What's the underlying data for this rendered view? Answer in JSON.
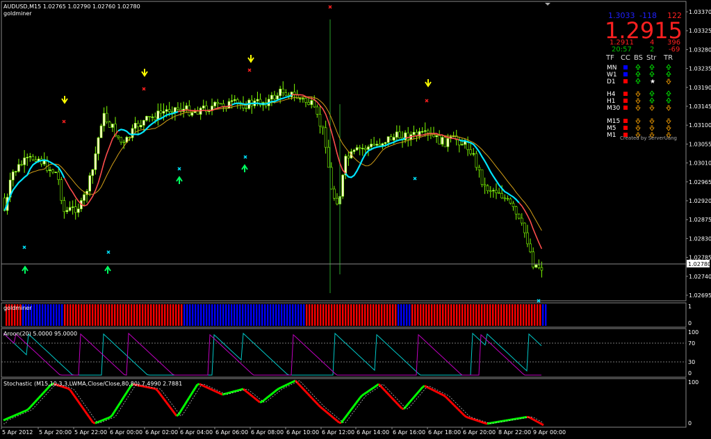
{
  "main_panel": {
    "header_line": "AUDUSD,M15  1.02765 1.02790 1.02760 1.02780",
    "indicator_name": "goldminer",
    "current_price_label": "1.02780",
    "y_ticks": [
      "1.03370",
      "1.03325",
      "1.03280",
      "1.03235",
      "1.03190",
      "1.03145",
      "1.03100",
      "1.03055",
      "1.03010",
      "1.02965",
      "1.02920",
      "1.02875",
      "1.02830",
      "1.02785",
      "1.02740",
      "1.02695"
    ]
  },
  "info_box": {
    "top_row": [
      "1.3033",
      "-118",
      "122"
    ],
    "top_colors": [
      "#2020ff",
      "#2020ff",
      "#ff2020"
    ],
    "big_price": "1.2915",
    "row2": [
      "1.2911",
      "4",
      "396"
    ],
    "row3": [
      "20:57",
      "2",
      "-69"
    ],
    "row3_colors": [
      "#00c000",
      "#00c000",
      "#ff2020"
    ],
    "headers": [
      "TF",
      "CC",
      "BS",
      "Str",
      "TR"
    ],
    "timeframes": [
      {
        "tf": "MN",
        "cc": "#0000ff",
        "bs": "up",
        "str": "up",
        "tr": "up"
      },
      {
        "tf": "W1",
        "cc": "#0000ff",
        "bs": "up",
        "str": "up",
        "tr": "up"
      },
      {
        "tf": "D1",
        "cc": "#ff0000",
        "bs": "up",
        "str": "star",
        "tr": "down"
      },
      {
        "tf": "H4",
        "cc": "#ff0000",
        "bs": "down",
        "str": "up",
        "tr": "up"
      },
      {
        "tf": "H1",
        "cc": "#ff0000",
        "bs": "down",
        "str": "up",
        "tr": "up"
      },
      {
        "tf": "M30",
        "cc": "#ff0000",
        "bs": "down",
        "str": "down",
        "tr": "down"
      },
      {
        "tf": "M15",
        "cc": "#ff0000",
        "bs": "down",
        "str": "down",
        "tr": "down"
      },
      {
        "tf": "M5",
        "cc": "#ff0000",
        "bs": "down",
        "str": "down",
        "tr": "down"
      },
      {
        "tf": "M1",
        "cc": "#ff0000",
        "bs": "down",
        "str": "down",
        "tr": "down"
      }
    ],
    "credit": "Created by ServerUang"
  },
  "goldminer_panel": {
    "label": "goldminer",
    "y_ticks": [
      "1",
      "0"
    ]
  },
  "aroon_panel": {
    "label": "Aroon(20) 5.0000 95.0000",
    "y_ticks": [
      "100",
      "70",
      "30",
      "0"
    ]
  },
  "stochastic_panel": {
    "label": "Stochastic (M15,10,3,3,LWMA,Close/Close,80,80) 7.4990 2.7881",
    "y_ticks": [
      "100",
      "0"
    ]
  },
  "time_axis": [
    "5 Apr 2012",
    "5 Apr 20:00",
    "5 Apr 22:00",
    "6 Apr 00:00",
    "6 Apr 02:00",
    "6 Apr 04:00",
    "6 Apr 06:00",
    "6 Apr 08:00",
    "6 Apr 10:00",
    "6 Apr 12:00",
    "6 Apr 14:00",
    "6 Apr 16:00",
    "6 Apr 18:00",
    "6 Apr 20:00",
    "8 Apr 22:00",
    "9 Apr 00:00"
  ],
  "colors": {
    "bull_candle": "#ffffcc",
    "bear_candle": "#b8f0a0",
    "wick": "#7fff00",
    "ma_fast": "#00e5ff",
    "ma_slow": "#ff4d4d",
    "ma_third": "#d4a017",
    "gm_blue": "#0000ff",
    "gm_red": "#ff0000",
    "aroon_up": "#00c8c8",
    "aroon_down": "#c000c0",
    "stoch_up": "#00ff00",
    "stoch_down": "#ff0000",
    "yellow_arrow": "#ffff00",
    "green_arrow": "#00ff60",
    "red_x": "#ff2020",
    "cyan_x": "#00e5ff"
  }
}
